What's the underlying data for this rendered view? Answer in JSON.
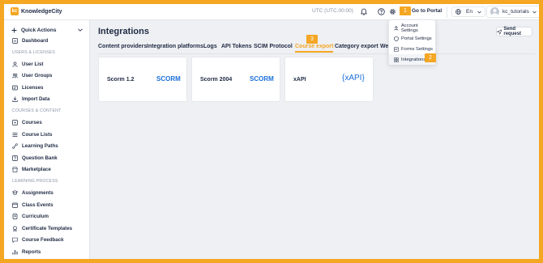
{
  "app": {
    "logo_text": "KnowledgeCity",
    "logo_mark": "kc"
  },
  "topbar": {
    "timezone": "UTC (UTC.00:00)",
    "portal_badge": "1",
    "portal_label": "Go to Portal",
    "language": "En",
    "username": "kc_tutorials",
    "icons": [
      "bell-icon",
      "help-icon",
      "gear-icon",
      "globe-icon"
    ]
  },
  "settings_menu": {
    "items": [
      {
        "label": "Account Settings",
        "icon": "user-cog-icon"
      },
      {
        "label": "Portal Settings",
        "icon": "shield-icon"
      },
      {
        "label": "Forms Settings",
        "icon": "form-icon"
      },
      {
        "label": "Integrations",
        "icon": "integrations-icon",
        "badge": "2"
      }
    ]
  },
  "sidebar": {
    "quick_actions": "Quick Actions",
    "dashboard": "Dashboard",
    "sections": [
      {
        "title": "USERS & LICENSES",
        "items": [
          "User List",
          "User Groups",
          "Licenses",
          "Import Data"
        ]
      },
      {
        "title": "COURSES & CONTENT",
        "items": [
          "Courses",
          "Course Lists",
          "Learning Paths",
          "Question Bank",
          "Marketplace"
        ]
      },
      {
        "title": "LEARNING PROCESS",
        "items": [
          "Assignments",
          "Class Events",
          "Curriculum",
          "Certificate Templates",
          "Course Feedback",
          "Reports"
        ]
      }
    ]
  },
  "main": {
    "title": "Integrations",
    "send_request": "Send request",
    "tabs": [
      "Content providers",
      "Integration platforms",
      "Logs",
      "API Tokens",
      "SCIM Protocol",
      "Course export",
      "Category export",
      "We"
    ],
    "active_tab_badge": "3",
    "cards": [
      {
        "name": "Scorm 1.2",
        "logo": "SCORM"
      },
      {
        "name": "Scorm 2004",
        "logo": "SCORM"
      },
      {
        "name": "xAPI",
        "logo": "{xAPI}"
      }
    ]
  },
  "colors": {
    "accent": "#f5a623",
    "text": "#1f2a44",
    "muted": "#8a94a6",
    "logo_blue": "#1b6fd8"
  }
}
